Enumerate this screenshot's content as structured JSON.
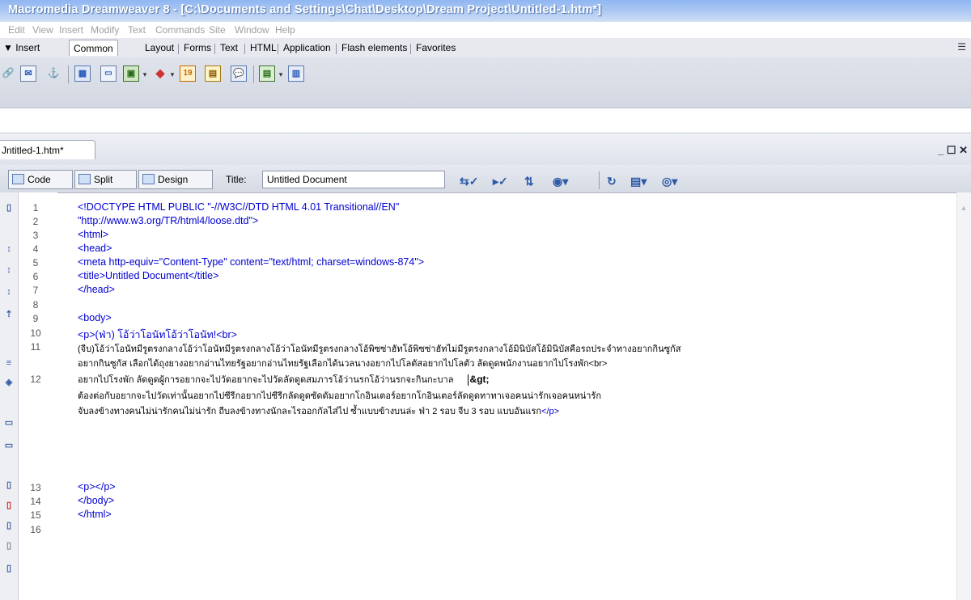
{
  "window": {
    "title": "Macromedia Dreamweaver 8 - [C:\\Documents and Settings\\Chat\\Desktop\\Dream Project\\Untitled-1.htm*]"
  },
  "menu": [
    "Edit",
    "View",
    "Insert",
    "Modify",
    "Text",
    "Commands",
    "Site",
    "Window",
    "Help"
  ],
  "insert_bar": {
    "label": "▼ Insert",
    "tabs": [
      "Common",
      "Layout",
      "Forms",
      "Text",
      "HTML",
      "Application",
      "Flash elements",
      "Favorites"
    ],
    "active_tab": "Common"
  },
  "document": {
    "tab_label": "Jntitled-1.htm*",
    "window_controls": "_ ☐ ✕",
    "views": [
      "Code",
      "Split",
      "Design"
    ],
    "title_label": "Title:",
    "title_value": "Untitled Document"
  },
  "code": {
    "line_numbers": [
      "1",
      "2",
      "3",
      "4",
      "5",
      "6",
      "7",
      "8",
      "9",
      "10",
      "11",
      "12",
      "13",
      "14",
      "15",
      "16"
    ],
    "lines": [
      "<!DOCTYPE HTML PUBLIC \"-//W3C//DTD HTML 4.01 Transitional//EN\"",
      "\"http://www.w3.org/TR/html4/loose.dtd\">",
      "<html>",
      "<head>",
      "<meta http-equiv=\"Content-Type\" content=\"text/html; charset=windows-874\">",
      "<title>Untitled Document</title>",
      "</head>",
      "",
      "<body>",
      "<p>(ฟ่า) โอ้ว่าโอนัทโอ้ว่าโอนัท!<br>",
      "(จีบ)โอ้ว่าโอนัทมีรูตรงกลางโอ้ว่าโอนัทมีรูตรงกลางโอ้ว่าโอนัทมีรูตรงกลางโอ้พิซซ่าฮัทโอ้พิซซ่าฮัทไม่มีรูตรงกลางโอ้มินิบัสโอ้มินิบัสคือรถประจำทางอยากกินซูกัส",
      "อยากกินซูกัส เลือกได้ถุงยางอยากอ่านไทยรัฐอยากอ่านไทยรัฐเลือกได้นวลนางอยากไปโลตัสอยากไปโลตัว ลัดดูดพนักงานอยากไปโรงพัก<br>",
      "อยากไปโรงพัก ลัดดูดผู้การอยากจะไปวัดอยากจะไปวัดลัดดูดสมภารโอ้ว่านรกโอ้ว่านรกจะกินกะบาล",
      "&gt;",
      "ต้องต่อกับอยากจะไปวัดเท่านั้นอยากไปซีรีกอยากไปซีรีกลัดดูดซัดดัมอยากโกอินเตอร์อยากโกอินเตอร์ลัดดูดทาทาเจอคนน่ารักเจอคนหน่ารัก",
      "จับลงข้างทางคนไม่น่ารักคนไม่น่ารัก ถีบลงข้างทางนักละไรออกกัลไส่ไป ซ้ำแบบข้างบนล่ะ ฟ่า 2 รอบ จีบ 3 รอบ แบบอันแรก",
      "</p>",
      "<p></p>",
      "</body>",
      "</html>"
    ]
  },
  "colors": {
    "title_gradient_start": "#8fb6f2",
    "code_tag": "#0000d2",
    "menu_disabled": "#a0a0a0"
  }
}
